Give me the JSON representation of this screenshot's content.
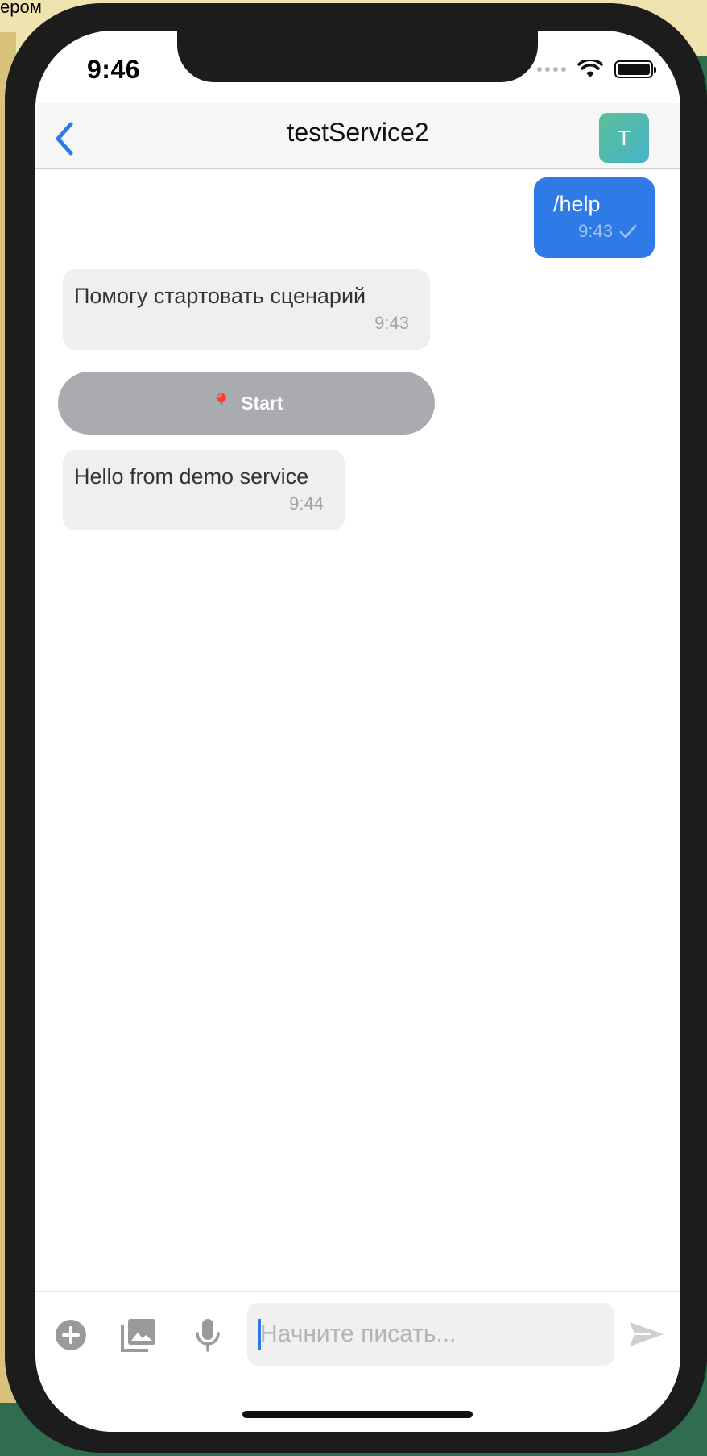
{
  "backdrop": {
    "stray_text": "ером"
  },
  "status_bar": {
    "time": "9:46"
  },
  "navbar": {
    "title": "testService2",
    "avatar_initial": "T"
  },
  "messages": [
    {
      "direction": "outgoing",
      "text": "/help",
      "time": "9:43",
      "status": "sent"
    },
    {
      "direction": "incoming",
      "text": "Помогу стартовать сценарий",
      "time": "9:43"
    },
    {
      "direction": "incoming",
      "text": "Hello from demo service",
      "time": "9:44"
    }
  ],
  "action_button": {
    "icon": "📍",
    "label": "Start"
  },
  "composer": {
    "placeholder": "Начните писать...",
    "value": ""
  },
  "icons": [
    "chevron-left-icon",
    "plus-circle-icon",
    "image-gallery-icon",
    "microphone-icon",
    "send-icon",
    "checkmark-icon",
    "wifi-icon",
    "battery-icon"
  ],
  "colors": {
    "accent": "#2e7be8",
    "bubble_in": "#efefef",
    "action_button": "#a9abae",
    "avatar": "#52bbb0"
  }
}
